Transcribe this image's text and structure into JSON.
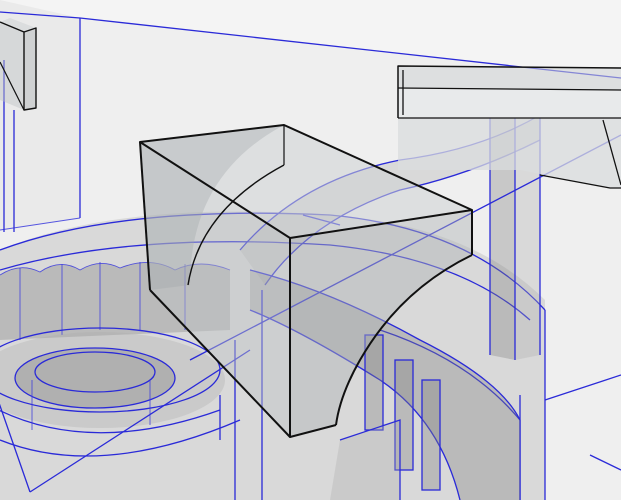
{
  "scene": {
    "background_color": "#f4f4f4",
    "guide_edge_color": "#2a2ad8",
    "selected_edge_color": "#111111",
    "face_color": "#b4b8ba"
  }
}
